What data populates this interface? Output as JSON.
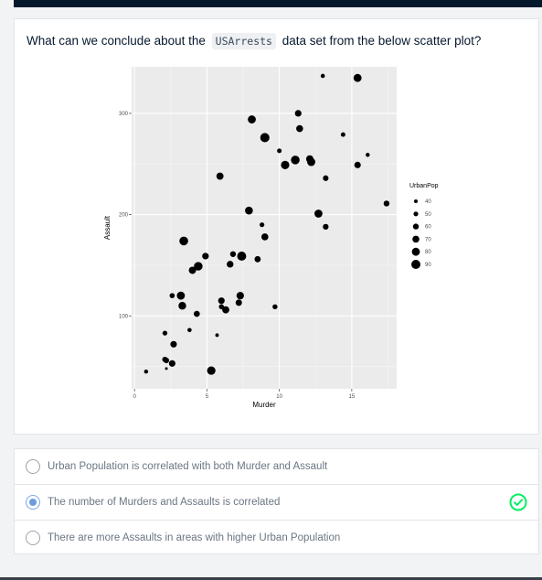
{
  "question": {
    "prefix": "What can we conclude about the",
    "code": "USArrests",
    "suffix": "data set from the below scatter plot?"
  },
  "chart_data": {
    "type": "scatter",
    "xlabel": "Murder",
    "ylabel": "Assault",
    "xlim": [
      -0.2,
      18.1
    ],
    "ylim": [
      28,
      346
    ],
    "x_ticks": [
      0,
      5,
      10,
      15
    ],
    "y_ticks": [
      100,
      200,
      300
    ],
    "grid": true,
    "legend_title": "UrbanPop",
    "legend_position": "right",
    "size_legend": [
      40,
      50,
      60,
      70,
      80,
      90
    ],
    "points": [
      {
        "x": 13.2,
        "y": 236,
        "size": 58
      },
      {
        "x": 10.0,
        "y": 263,
        "size": 48
      },
      {
        "x": 8.1,
        "y": 294,
        "size": 80
      },
      {
        "x": 8.8,
        "y": 190,
        "size": 50
      },
      {
        "x": 9.0,
        "y": 276,
        "size": 91
      },
      {
        "x": 7.9,
        "y": 204,
        "size": 78
      },
      {
        "x": 3.3,
        "y": 110,
        "size": 77
      },
      {
        "x": 5.9,
        "y": 238,
        "size": 72
      },
      {
        "x": 15.4,
        "y": 335,
        "size": 80
      },
      {
        "x": 17.4,
        "y": 211,
        "size": 60
      },
      {
        "x": 5.3,
        "y": 46,
        "size": 83
      },
      {
        "x": 2.6,
        "y": 120,
        "size": 54
      },
      {
        "x": 10.4,
        "y": 249,
        "size": 83
      },
      {
        "x": 7.2,
        "y": 113,
        "size": 65
      },
      {
        "x": 2.2,
        "y": 56,
        "size": 57
      },
      {
        "x": 6.0,
        "y": 115,
        "size": 66
      },
      {
        "x": 9.7,
        "y": 109,
        "size": 52
      },
      {
        "x": 15.4,
        "y": 249,
        "size": 66
      },
      {
        "x": 2.1,
        "y": 83,
        "size": 51
      },
      {
        "x": 11.3,
        "y": 300,
        "size": 67
      },
      {
        "x": 4.4,
        "y": 149,
        "size": 85
      },
      {
        "x": 12.1,
        "y": 255,
        "size": 74
      },
      {
        "x": 2.7,
        "y": 72,
        "size": 66
      },
      {
        "x": 16.1,
        "y": 259,
        "size": 44
      },
      {
        "x": 9.0,
        "y": 178,
        "size": 70
      },
      {
        "x": 6.0,
        "y": 109,
        "size": 53
      },
      {
        "x": 4.3,
        "y": 102,
        "size": 62
      },
      {
        "x": 12.2,
        "y": 252,
        "size": 81
      },
      {
        "x": 2.1,
        "y": 57,
        "size": 56
      },
      {
        "x": 7.4,
        "y": 159,
        "size": 89
      },
      {
        "x": 11.4,
        "y": 285,
        "size": 70
      },
      {
        "x": 11.1,
        "y": 254,
        "size": 86
      },
      {
        "x": 13.0,
        "y": 337,
        "size": 45
      },
      {
        "x": 0.8,
        "y": 45,
        "size": 44
      },
      {
        "x": 7.3,
        "y": 120,
        "size": 75
      },
      {
        "x": 6.6,
        "y": 151,
        "size": 68
      },
      {
        "x": 4.9,
        "y": 159,
        "size": 67
      },
      {
        "x": 6.3,
        "y": 106,
        "size": 72
      },
      {
        "x": 3.4,
        "y": 174,
        "size": 87
      },
      {
        "x": 14.4,
        "y": 279,
        "size": 48
      },
      {
        "x": 3.8,
        "y": 86,
        "size": 45
      },
      {
        "x": 13.2,
        "y": 188,
        "size": 59
      },
      {
        "x": 12.7,
        "y": 201,
        "size": 80
      },
      {
        "x": 3.2,
        "y": 120,
        "size": 80
      },
      {
        "x": 2.2,
        "y": 48,
        "size": 32
      },
      {
        "x": 8.5,
        "y": 156,
        "size": 63
      },
      {
        "x": 4.0,
        "y": 145,
        "size": 73
      },
      {
        "x": 5.7,
        "y": 81,
        "size": 39
      },
      {
        "x": 2.6,
        "y": 53,
        "size": 66
      },
      {
        "x": 6.8,
        "y": 161,
        "size": 60
      }
    ]
  },
  "options": [
    {
      "label": "Urban Population is correlated with both Murder and Assault",
      "selected": false
    },
    {
      "label": "The number of Murders and Assaults is correlated",
      "selected": true
    },
    {
      "label": "There are more Assaults in areas with higher Urban Population",
      "selected": false
    }
  ],
  "colors": {
    "accent": "#6c9be0",
    "correct": "#03ef62",
    "panel": "#ebebeb",
    "header": "#05192d"
  }
}
